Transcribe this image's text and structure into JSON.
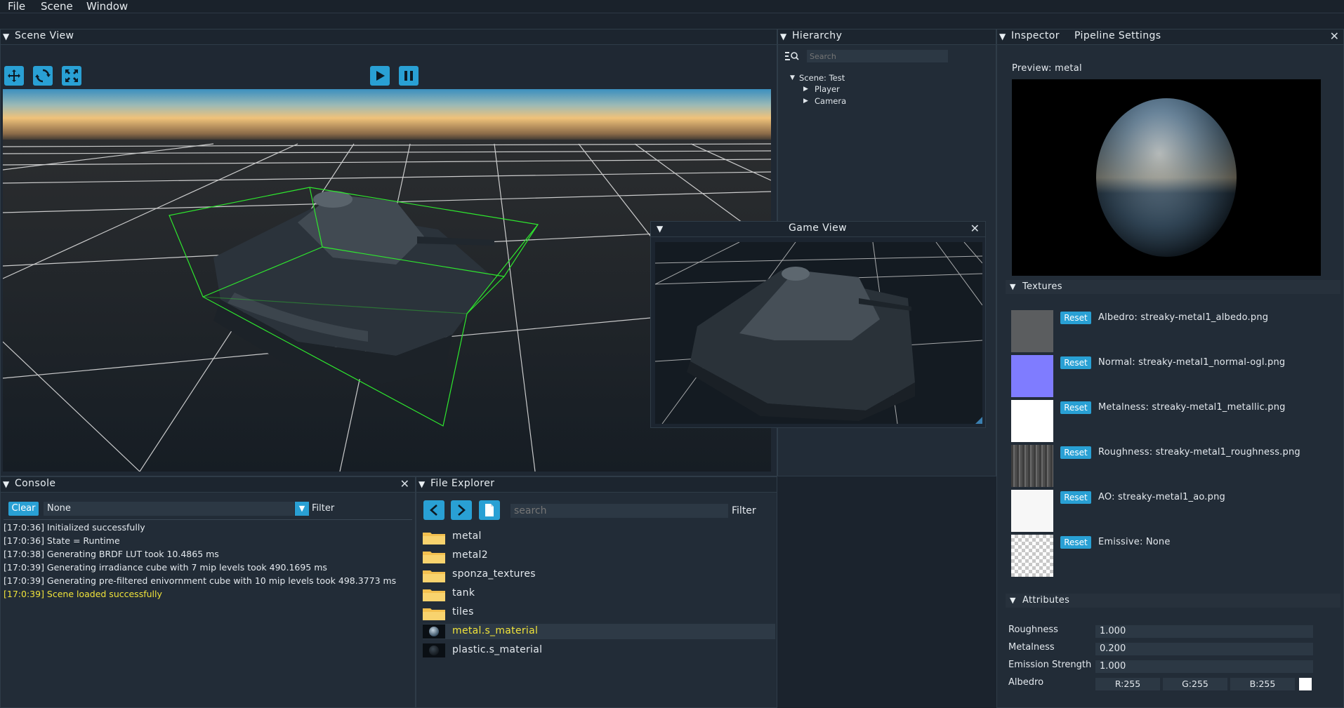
{
  "menu": [
    "File",
    "Scene",
    "Window"
  ],
  "scene_view": {
    "title": "Scene View",
    "tools": [
      "move-icon",
      "rotate-icon",
      "scale-icon"
    ],
    "play": "play-icon",
    "pause": "pause-icon"
  },
  "hierarchy": {
    "title": "Hierarchy",
    "search_placeholder": "Search",
    "root": "Scene: Test",
    "children": [
      "Player",
      "Camera"
    ]
  },
  "inspector": {
    "tabs": [
      "Inspector",
      "Pipeline Settings"
    ],
    "preview_label": "Preview: metal",
    "textures_header": "Textures",
    "reset_label": "Reset",
    "textures": [
      {
        "label": "Albedro: streaky-metal1_albedo.png",
        "swatch": "#5b5d5f"
      },
      {
        "label": "Normal: streaky-metal1_normal-ogl.png",
        "swatch": "#7f7cff"
      },
      {
        "label": "Metalness: streaky-metal1_metallic.png",
        "swatch": "#ffffff"
      },
      {
        "label": "Roughness: streaky-metal1_roughness.png",
        "swatch": "#4a4a4a"
      },
      {
        "label": "AO: streaky-metal1_ao.png",
        "swatch": "#f7f7f7"
      },
      {
        "label": "Emissive: None",
        "swatch": "checker"
      }
    ],
    "attributes_header": "Attributes",
    "attributes": [
      {
        "label": "Roughness",
        "value": "1.000"
      },
      {
        "label": "Metalness",
        "value": "0.200"
      },
      {
        "label": "Emission Strength",
        "value": "1.000"
      }
    ],
    "albedo": {
      "label": "Albedro",
      "r": "R:255",
      "g": "G:255",
      "b": "B:255",
      "color": "#ffffff"
    }
  },
  "game_view": {
    "title": "Game View"
  },
  "console": {
    "title": "Console",
    "clear_label": "Clear",
    "filter_value": "None",
    "filter_label": "Filter",
    "lines": [
      {
        "text": "[17:0:36] Initialized successfully",
        "level": "info"
      },
      {
        "text": "[17:0:36] State = Runtime",
        "level": "info"
      },
      {
        "text": "[17:0:38] Generating BRDF LUT took 10.4865 ms",
        "level": "info"
      },
      {
        "text": "[17:0:39] Generating irradiance cube with 7 mip levels took 490.1695 ms",
        "level": "info"
      },
      {
        "text": "[17:0:39] Generating pre-filtered enivornment cube with 10 mip levels took 498.3773 ms",
        "level": "info"
      },
      {
        "text": "[17:0:39] Scene loaded successfully",
        "level": "warning"
      }
    ]
  },
  "file_explorer": {
    "title": "File Explorer",
    "search_placeholder": "search",
    "filter_label": "Filter",
    "items": [
      {
        "name": "metal",
        "kind": "folder"
      },
      {
        "name": "metal2",
        "kind": "folder"
      },
      {
        "name": "sponza_textures",
        "kind": "folder"
      },
      {
        "name": "tank",
        "kind": "folder"
      },
      {
        "name": "tiles",
        "kind": "folder"
      },
      {
        "name": "metal.s_material",
        "kind": "material",
        "selected": true
      },
      {
        "name": "plastic.s_material",
        "kind": "material"
      }
    ]
  },
  "colors": {
    "accent": "#29a0d4",
    "highlight_text": "#f0e33a",
    "bbox": "#2ee82e"
  }
}
